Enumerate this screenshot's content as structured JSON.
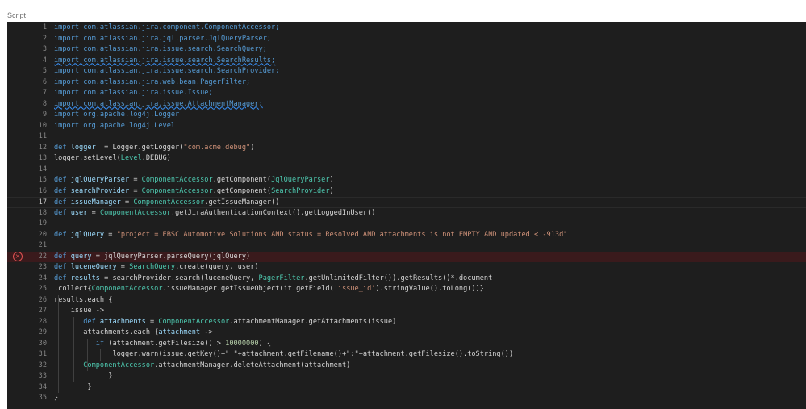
{
  "section_label": "Script",
  "editor": {
    "current_line": 17,
    "error_line": 22,
    "lines": [
      {
        "n": "1",
        "t": [
          [
            "kw",
            "import com.atlassian.jira.component.ComponentAccessor;"
          ]
        ]
      },
      {
        "n": "2",
        "t": [
          [
            "kw",
            "import com.atlassian.jira.jql.parser.JqlQueryParser;"
          ]
        ]
      },
      {
        "n": "3",
        "t": [
          [
            "kw",
            "import com.atlassian.jira.issue.search.SearchQuery;"
          ]
        ]
      },
      {
        "n": "4",
        "t": [
          [
            "kw sq",
            "import com.atlassian.jira.issue.search.SearchResults;"
          ]
        ]
      },
      {
        "n": "5",
        "t": [
          [
            "kw",
            "import com.atlassian.jira.issue.search.SearchProvider;"
          ]
        ]
      },
      {
        "n": "6",
        "t": [
          [
            "kw",
            "import com.atlassian.jira.web.bean.PagerFilter;"
          ]
        ]
      },
      {
        "n": "7",
        "t": [
          [
            "kw",
            "import com.atlassian.jira.issue.Issue;"
          ]
        ]
      },
      {
        "n": "8",
        "t": [
          [
            "kw sq",
            "import com.atlassian.jira.issue.AttachmentManager;"
          ]
        ]
      },
      {
        "n": "9",
        "t": [
          [
            "kw",
            "import org.apache.log4j.Logger"
          ]
        ]
      },
      {
        "n": "10",
        "t": [
          [
            "kw",
            "import org.apache.log4j.Level"
          ]
        ]
      },
      {
        "n": "11",
        "t": []
      },
      {
        "n": "12",
        "t": [
          [
            "kw",
            "def "
          ],
          [
            "var",
            "logger"
          ],
          [
            "",
            "  = Logger.getLogger("
          ],
          [
            "str",
            "\"com.acme.debug\""
          ],
          [
            "",
            ")"
          ]
        ]
      },
      {
        "n": "13",
        "t": [
          [
            "",
            "logger.setLevel("
          ],
          [
            "ty",
            "Level"
          ],
          [
            "",
            ".DEBUG)"
          ]
        ]
      },
      {
        "n": "14",
        "t": []
      },
      {
        "n": "15",
        "t": [
          [
            "kw",
            "def "
          ],
          [
            "var",
            "jqlQueryParser"
          ],
          [
            "",
            " = "
          ],
          [
            "ty",
            "ComponentAccessor"
          ],
          [
            "",
            ".getComponent("
          ],
          [
            "ty",
            "JqlQueryParser"
          ],
          [
            "",
            ")"
          ]
        ]
      },
      {
        "n": "16",
        "t": [
          [
            "kw",
            "def "
          ],
          [
            "var",
            "searchProvider"
          ],
          [
            "",
            " = "
          ],
          [
            "ty",
            "ComponentAccessor"
          ],
          [
            "",
            ".getComponent("
          ],
          [
            "ty",
            "SearchProvider"
          ],
          [
            "",
            ")"
          ]
        ]
      },
      {
        "n": "17",
        "t": [
          [
            "kw",
            "def "
          ],
          [
            "var",
            "issueManager"
          ],
          [
            "",
            " = "
          ],
          [
            "ty",
            "ComponentAccessor"
          ],
          [
            "",
            ".getIssueManager()"
          ]
        ]
      },
      {
        "n": "18",
        "t": [
          [
            "kw",
            "def "
          ],
          [
            "var",
            "user"
          ],
          [
            "",
            " = "
          ],
          [
            "ty",
            "ComponentAccessor"
          ],
          [
            "",
            ".getJiraAuthenticationContext().getLoggedInUser()"
          ]
        ]
      },
      {
        "n": "19",
        "t": []
      },
      {
        "n": "20",
        "t": [
          [
            "kw",
            "def "
          ],
          [
            "var",
            "jqlQuery"
          ],
          [
            "",
            " = "
          ],
          [
            "str",
            "\"project = EBSC Automotive Solutions AND status = Resolved AND attachments is not EMPTY AND updated < -913d\""
          ]
        ]
      },
      {
        "n": "21",
        "t": []
      },
      {
        "n": "22",
        "t": [
          [
            "kw",
            "def "
          ],
          [
            "var",
            "query"
          ],
          [
            "",
            " = jqlQueryParser.parseQuery(jqlQuery)"
          ]
        ]
      },
      {
        "n": "23",
        "t": [
          [
            "kw",
            "def "
          ],
          [
            "var",
            "luceneQuery"
          ],
          [
            "",
            " = "
          ],
          [
            "ty",
            "SearchQuery"
          ],
          [
            "",
            ".create(query, user)"
          ]
        ]
      },
      {
        "n": "24",
        "t": [
          [
            "kw",
            "def "
          ],
          [
            "var",
            "results"
          ],
          [
            "",
            " = searchProvider.search(luceneQuery, "
          ],
          [
            "ty",
            "PagerFilter"
          ],
          [
            "",
            ".getUnlimitedFilter()).getResults()*.document"
          ]
        ]
      },
      {
        "n": "25",
        "t": [
          [
            "",
            ".collect{"
          ],
          [
            "ty",
            "ComponentAccessor"
          ],
          [
            "",
            ".issueManager.getIssueObject(it.getField("
          ],
          [
            "str",
            "'issue_id'"
          ],
          [
            "",
            ").stringValue().toLong())}"
          ]
        ]
      },
      {
        "n": "26",
        "t": [
          [
            "",
            "results.each {"
          ]
        ]
      },
      {
        "n": "27",
        "t": [
          [
            "",
            "    issue ->"
          ]
        ]
      },
      {
        "n": "28",
        "t": [
          [
            "",
            "       "
          ],
          [
            "kw",
            "def "
          ],
          [
            "var",
            "attachments"
          ],
          [
            "",
            " = "
          ],
          [
            "ty",
            "ComponentAccessor"
          ],
          [
            "",
            ".attachmentManager.getAttachments(issue)"
          ]
        ]
      },
      {
        "n": "29",
        "t": [
          [
            "",
            "       attachments.each {"
          ],
          [
            "var",
            "attachment"
          ],
          [
            "",
            " ->"
          ]
        ]
      },
      {
        "n": "30",
        "t": [
          [
            "",
            "          "
          ],
          [
            "kw",
            "if"
          ],
          [
            "",
            " (attachment.getFilesize() > "
          ],
          [
            "num",
            "10000000"
          ],
          [
            "",
            ") {"
          ]
        ]
      },
      {
        "n": "31",
        "t": [
          [
            "",
            "              logger.warn(issue.getKey()+\" \"+attachment.getFilename()+\":\"+attachment.getFilesize().toString())"
          ]
        ]
      },
      {
        "n": "32",
        "t": [
          [
            "",
            "       "
          ],
          [
            "ty",
            "ComponentAccessor"
          ],
          [
            "",
            ".attachmentManager.deleteAttachment(attachment)"
          ]
        ]
      },
      {
        "n": "33",
        "t": [
          [
            "",
            "             }"
          ]
        ]
      },
      {
        "n": "34",
        "t": [
          [
            "",
            "        }"
          ]
        ]
      },
      {
        "n": "35",
        "t": [
          [
            "",
            "}"
          ]
        ]
      }
    ]
  },
  "colors": {
    "editor_bg": "#1e1e1e",
    "keyword": "#569cd6",
    "type": "#4ec9b0",
    "string": "#ce9178",
    "number": "#b5cea8",
    "variable": "#9cdcfe",
    "error_line_bg": "#3a1a1c",
    "error_icon": "#e05252"
  },
  "icons": {
    "error_gutter": "error-circle-icon"
  }
}
